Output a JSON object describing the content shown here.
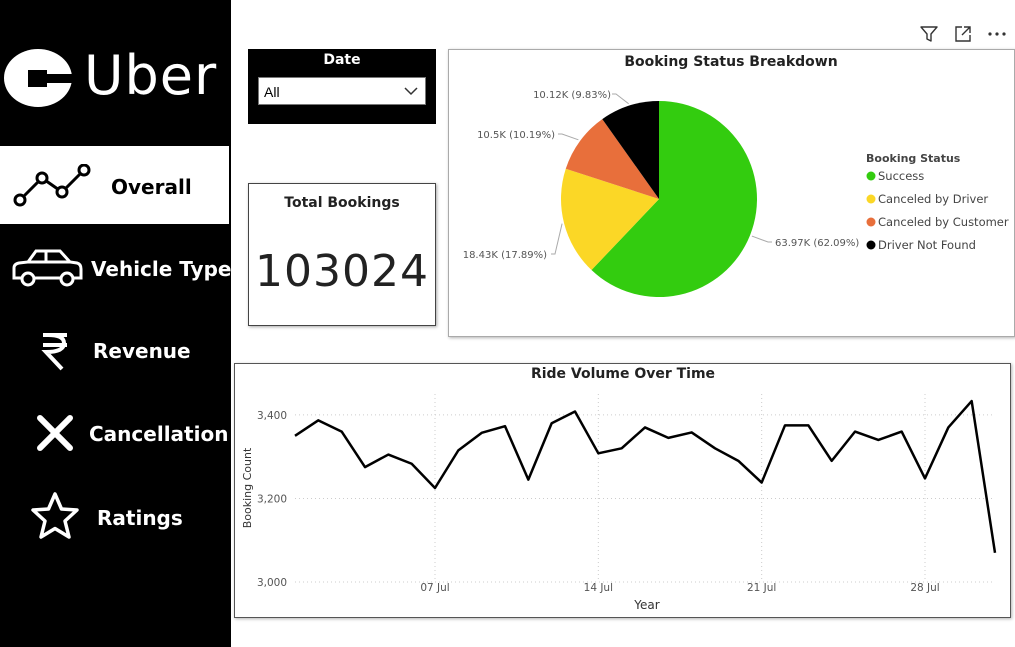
{
  "logo": {
    "text": "Uber"
  },
  "nav": [
    {
      "label": "Overall",
      "icon": "trend-line-icon",
      "active": true
    },
    {
      "label": "Vehicle Type",
      "icon": "car-icon",
      "active": false
    },
    {
      "label": "Revenue",
      "icon": "rupee-icon",
      "active": false
    },
    {
      "label": "Cancellation",
      "icon": "close-icon",
      "active": false
    },
    {
      "label": "Ratings",
      "icon": "star-icon",
      "active": false
    }
  ],
  "toolbar": {
    "icons": [
      "filter-icon",
      "focus-mode-icon",
      "more-options-icon"
    ]
  },
  "date_filter": {
    "title": "Date",
    "value": "All"
  },
  "kpi": {
    "title": "Total Bookings",
    "value": "103024"
  },
  "colors": {
    "success": "#33cc0f",
    "canceled_driver": "#fbd726",
    "canceled_customer": "#e86f3b",
    "not_found": "#000000"
  },
  "chart_data": [
    {
      "type": "pie",
      "title": "Booking Status Breakdown",
      "legend_title": "Booking Status",
      "legend_position": "right",
      "slices": [
        {
          "name": "Success",
          "value": 63970,
          "label": "63.97K (62.09%)",
          "color": "#33cc0f"
        },
        {
          "name": "Canceled by Driver",
          "value": 18430,
          "label": "18.43K (17.89%)",
          "color": "#fbd726"
        },
        {
          "name": "Canceled by Customer",
          "value": 10500,
          "label": "10.5K (10.19%)",
          "color": "#e86f3b"
        },
        {
          "name": "Driver Not Found",
          "value": 10120,
          "label": "10.12K (9.83%)",
          "color": "#000000"
        }
      ]
    },
    {
      "type": "line",
      "title": "Ride Volume Over Time",
      "xlabel": "Year",
      "ylabel": "Booking Count",
      "ylim": [
        3000,
        3450
      ],
      "yticks": [
        3000,
        3200,
        3400
      ],
      "ytick_labels": [
        "3,000",
        "3,200",
        "3,400"
      ],
      "xtick_days": [
        7,
        14,
        21,
        28
      ],
      "xtick_labels": [
        "07 Jul",
        "14 Jul",
        "21 Jul",
        "28 Jul"
      ],
      "grid": true,
      "x": [
        1,
        2,
        3,
        4,
        5,
        6,
        7,
        8,
        9,
        10,
        11,
        12,
        13,
        14,
        15,
        16,
        17,
        18,
        19,
        20,
        21,
        22,
        23,
        24,
        25,
        26,
        27,
        28,
        29,
        30,
        31
      ],
      "values": [
        3350,
        3387,
        3360,
        3275,
        3305,
        3283,
        3225,
        3315,
        3357,
        3373,
        3245,
        3380,
        3408,
        3308,
        3320,
        3370,
        3345,
        3358,
        3320,
        3290,
        3238,
        3375,
        3375,
        3290,
        3360,
        3340,
        3360,
        3248,
        3370,
        3433,
        3070
      ]
    }
  ]
}
